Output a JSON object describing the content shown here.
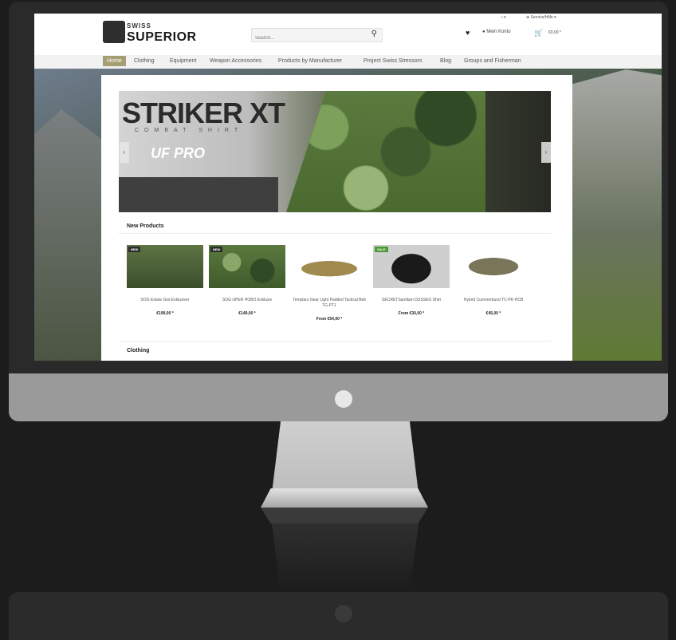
{
  "header": {
    "logo_small": "SWISS",
    "logo_text": "SUPERIOR",
    "search_placeholder": "Search...",
    "language": "▪ ▾",
    "service": "⊕ Service/Hilfe ▾",
    "account": "Mein Konto",
    "cart_total": "€0,00 *"
  },
  "nav": [
    {
      "label": "Home"
    },
    {
      "label": "Clothing"
    },
    {
      "label": "Equipment"
    },
    {
      "label": "Weapon Accessories"
    },
    {
      "label": "Products by Manufacturer"
    },
    {
      "label": "Project Swiss Stressors"
    },
    {
      "label": "Blog"
    },
    {
      "label": "Groups and Fisherman"
    }
  ],
  "banner": {
    "title": "STRIKER XT",
    "subtitle": "COMBAT SHIRT",
    "brand": "UF PRO"
  },
  "sections": {
    "new_products": "New Products",
    "clothing": "Clothing"
  },
  "products": [
    {
      "badge": "NEW",
      "name": "SOG Estate Gist Exklusiver",
      "price": "€199,00 *"
    },
    {
      "badge": "NEW",
      "name": "SOG UPER HOBO Exklusiv",
      "price": "€149,00 *"
    },
    {
      "badge": "",
      "name": "Templars Gear Light Padded Tactical Belt TG-PT1",
      "price": "From €54,00 *"
    },
    {
      "badge": "SALE",
      "name": "SECRETSamllam DUSSEG Shirt",
      "price": "From €30,00 *"
    },
    {
      "badge": "",
      "name": "Hybrid Cummerbund TC-PK-HCB",
      "price": "€45,00 *"
    }
  ],
  "colors": {
    "nav_active": "#a59e73",
    "badge_new": "#2d2d2d",
    "badge_sale": "#4a9a35"
  }
}
